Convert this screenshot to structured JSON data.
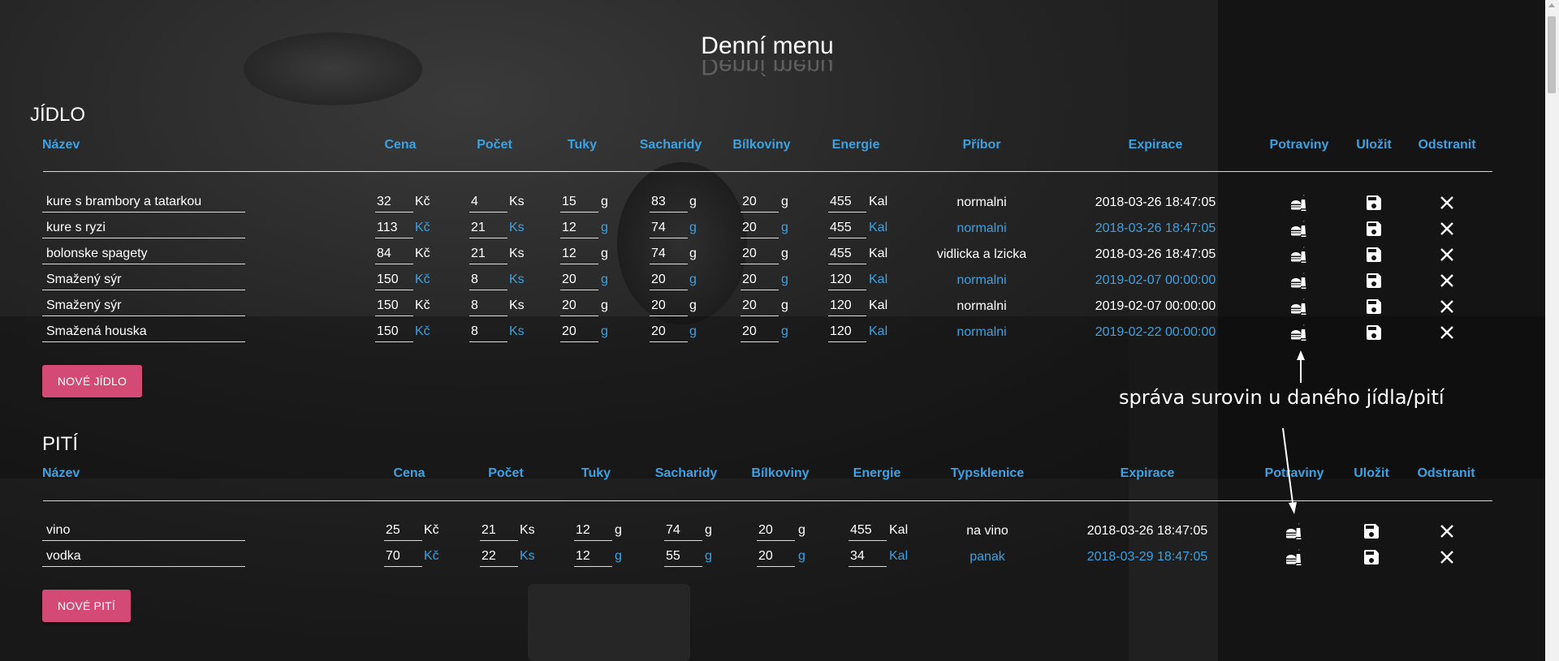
{
  "page": {
    "title": "Denní menu"
  },
  "food": {
    "section_title": "JÍDLO",
    "headers": {
      "name": "Název",
      "price": "Cena",
      "count": "Počet",
      "fat": "Tuky",
      "carbs": "Sacharidy",
      "protein": "Bílkoviny",
      "energy": "Energie",
      "extra": "Příbor",
      "expiry": "Expirace",
      "ingredients": "Potraviny",
      "save": "Uložit",
      "remove": "Odstranit"
    },
    "rows": [
      {
        "name": "kure s brambory a tatarkou",
        "price": "32",
        "count": "4",
        "fat": "15",
        "carbs": "83",
        "protein": "20",
        "energy": "455",
        "extra": "normalni",
        "expiry": "2018-03-26 18:47:05",
        "highlight": false
      },
      {
        "name": "kure s ryzi",
        "price": "113",
        "count": "21",
        "fat": "12",
        "carbs": "74",
        "protein": "20",
        "energy": "455",
        "extra": "normalni",
        "expiry": "2018-03-26 18:47:05",
        "highlight": true
      },
      {
        "name": "bolonske spagety",
        "price": "84",
        "count": "21",
        "fat": "12",
        "carbs": "74",
        "protein": "20",
        "energy": "455",
        "extra": "vidlicka a lzicka",
        "expiry": "2018-03-26 18:47:05",
        "highlight": false
      },
      {
        "name": "Smažený sýr",
        "price": "150",
        "count": "8",
        "fat": "20",
        "carbs": "20",
        "protein": "20",
        "energy": "120",
        "extra": "normalni",
        "expiry": "2019-02-07 00:00:00",
        "highlight": true
      },
      {
        "name": "Smažený sýr",
        "price": "150",
        "count": "8",
        "fat": "20",
        "carbs": "20",
        "protein": "20",
        "energy": "120",
        "extra": "normalni",
        "expiry": "2019-02-07 00:00:00",
        "highlight": false
      },
      {
        "name": "Smažená houska",
        "price": "150",
        "count": "8",
        "fat": "20",
        "carbs": "20",
        "protein": "20",
        "energy": "120",
        "extra": "normalni",
        "expiry": "2019-02-22 00:00:00",
        "highlight": true
      }
    ],
    "new_button": "NOVÉ JÍDLO"
  },
  "drink": {
    "section_title": "PITÍ",
    "headers": {
      "name": "Název",
      "price": "Cena",
      "count": "Počet",
      "fat": "Tuky",
      "carbs": "Sacharidy",
      "protein": "Bílkoviny",
      "energy": "Energie",
      "extra": "Typsklenice",
      "expiry": "Expirace",
      "ingredients": "Potraviny",
      "save": "Uložit",
      "remove": "Odstranit"
    },
    "rows": [
      {
        "name": "vino",
        "price": "25",
        "count": "21",
        "fat": "12",
        "carbs": "74",
        "protein": "20",
        "energy": "455",
        "extra": "na vino",
        "expiry": "2018-03-26 18:47:05",
        "highlight": false
      },
      {
        "name": "vodka",
        "price": "70",
        "count": "22",
        "fat": "12",
        "carbs": "55",
        "protein": "20",
        "energy": "34",
        "extra": "panak",
        "expiry": "2018-03-29 18:47:05",
        "highlight": true
      }
    ],
    "new_button": "NOVÉ PITÍ"
  },
  "units": {
    "price": "Kč",
    "count": "Ks",
    "fat": "g",
    "carbs": "g",
    "protein": "g",
    "energy": "Kal"
  },
  "annotation": "správa surovin u daného jídla/pití",
  "icons": {
    "ingredients": "food-icon",
    "save": "floppy-disk-icon",
    "remove": "close-icon"
  },
  "colors": {
    "accent": "#3ba2e3",
    "button": "#d44a76",
    "background": "#1c1c1c"
  }
}
